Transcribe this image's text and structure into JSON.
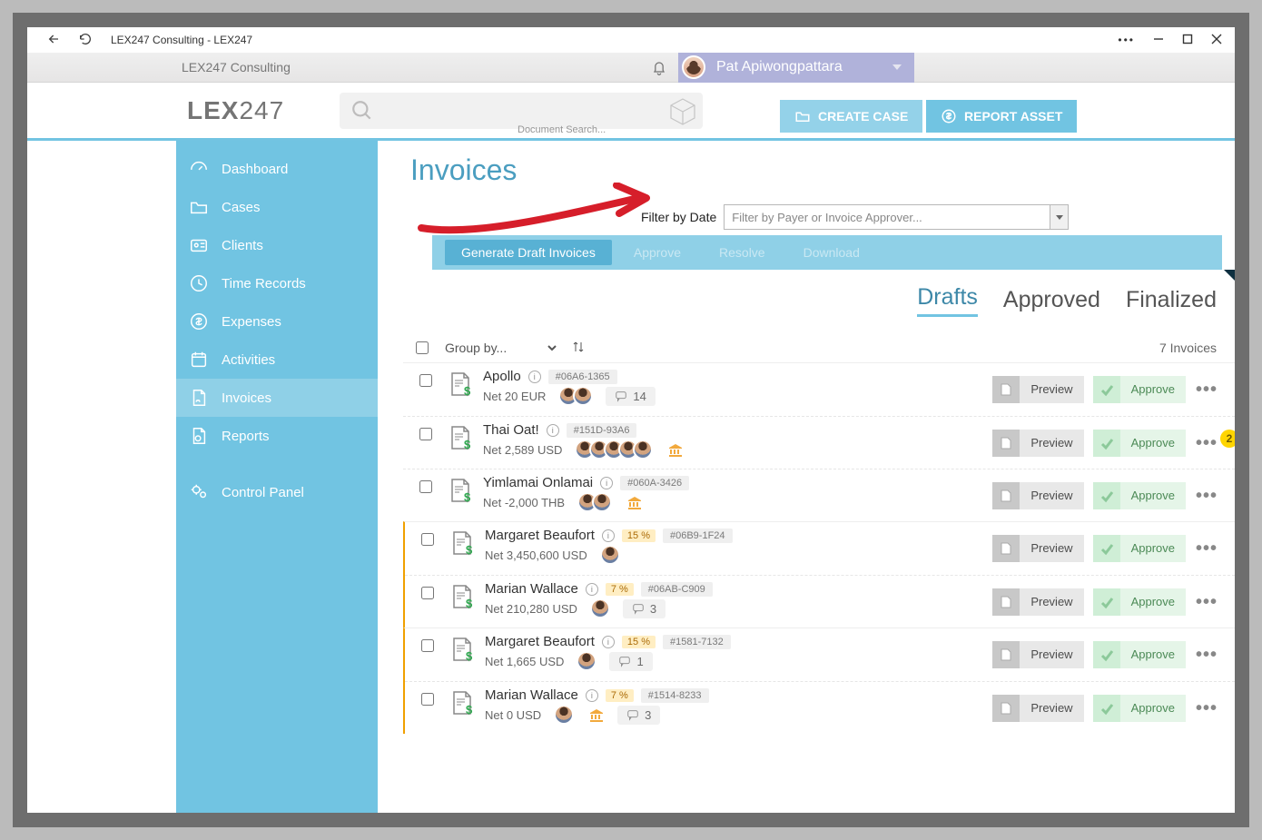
{
  "window": {
    "title": "LEX247 Consulting - LEX247"
  },
  "topbar": {
    "org": "LEX247 Consulting",
    "user": "Pat Apiwongpattara"
  },
  "logo": {
    "prefix": "LEX",
    "suffix": "247"
  },
  "search": {
    "placeholder": "Document Search..."
  },
  "header_buttons": {
    "create": "CREATE CASE",
    "report": "REPORT ASSET"
  },
  "sidebar": {
    "items": [
      {
        "label": "Dashboard"
      },
      {
        "label": "Cases"
      },
      {
        "label": "Clients"
      },
      {
        "label": "Time Records"
      },
      {
        "label": "Expenses"
      },
      {
        "label": "Activities"
      },
      {
        "label": "Invoices",
        "active": true
      },
      {
        "label": "Reports"
      }
    ],
    "footer_label": "Control Panel"
  },
  "page": {
    "title": "Invoices"
  },
  "filter": {
    "date_label": "Filter by Date",
    "combo_placeholder": "Filter by Payer or Invoice Approver..."
  },
  "actions": {
    "generate": "Generate Draft Invoices",
    "approve": "Approve",
    "resolve": "Resolve",
    "download": "Download"
  },
  "tabs": {
    "drafts": "Drafts",
    "approved": "Approved",
    "finalized": "Finalized"
  },
  "list": {
    "groupby_placeholder": "Group by...",
    "count_label": "7 Invoices"
  },
  "btnlabels": {
    "preview": "Preview",
    "approve": "Approve"
  },
  "rows": [
    {
      "name": "Apollo",
      "code": "#06A6-1365",
      "net": "Net 20 EUR",
      "avatars": 2,
      "bank": false,
      "comments": "14",
      "pct": null,
      "badge": null
    },
    {
      "name": "Thai Oat!",
      "code": "#151D-93A6",
      "net": "Net 2,589 USD",
      "avatars": 5,
      "bank": true,
      "comments": null,
      "pct": null,
      "badge": "2"
    },
    {
      "name": "Yimlamai Onlamai",
      "code": "#060A-3426",
      "net": "Net -2,000 THB",
      "avatars": 2,
      "bank": true,
      "comments": null,
      "pct": null,
      "badge": null
    },
    {
      "name": "Margaret Beaufort",
      "code": "#06B9-1F24",
      "net": "Net 3,450,600 USD",
      "avatars": 1,
      "bank": false,
      "comments": null,
      "pct": "15 %",
      "badge": null
    },
    {
      "name": "Marian Wallace",
      "code": "#06AB-C909",
      "net": "Net 210,280 USD",
      "avatars": 1,
      "bank": false,
      "comments": "3",
      "pct": "7 %",
      "badge": null
    },
    {
      "name": "Margaret Beaufort",
      "code": "#1581-7132",
      "net": "Net 1,665 USD",
      "avatars": 1,
      "bank": false,
      "comments": "1",
      "pct": "15 %",
      "badge": null
    },
    {
      "name": "Marian Wallace",
      "code": "#1514-8233",
      "net": "Net 0 USD",
      "avatars": 1,
      "bank": true,
      "comments": "3",
      "pct": "7 %",
      "badge": null
    }
  ]
}
